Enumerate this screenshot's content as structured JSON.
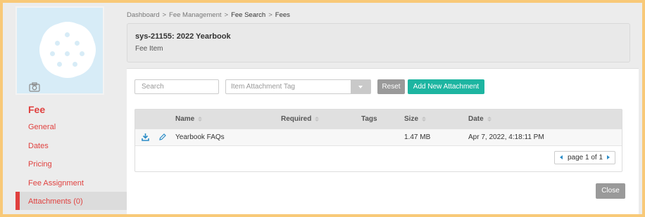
{
  "sidebar": {
    "title": "Fee",
    "items": [
      {
        "label": "General"
      },
      {
        "label": "Dates"
      },
      {
        "label": "Pricing"
      },
      {
        "label": "Fee Assignment"
      },
      {
        "label": "Attachments (0)"
      }
    ],
    "photo_icon": "camera-icon"
  },
  "breadcrumb": [
    "Dashboard",
    ">",
    "Fee Management",
    ">",
    "Fee Search",
    ">",
    "Fees"
  ],
  "header": {
    "title": "sys-21155: 2022 Yearbook",
    "subtitle": "Fee Item"
  },
  "toolbar": {
    "search_placeholder": "Search",
    "tag_placeholder": "Item Attachment Tag",
    "reset_label": "Reset",
    "add_label": "Add New Attachment"
  },
  "table": {
    "columns": [
      "Name",
      "Required",
      "Tags",
      "Size",
      "Date"
    ],
    "rows": [
      {
        "name": "Yearbook FAQs",
        "required": "",
        "tags": "",
        "size": "1.47 MB",
        "date": "Apr 7, 2022, 4:18:11 PM"
      }
    ]
  },
  "pager": {
    "label": "page 1 of 1"
  },
  "close_label": "Close",
  "colors": {
    "accent": "#e0413f",
    "primary": "#1db5a1",
    "photo_bg": "#d7ecf7"
  }
}
